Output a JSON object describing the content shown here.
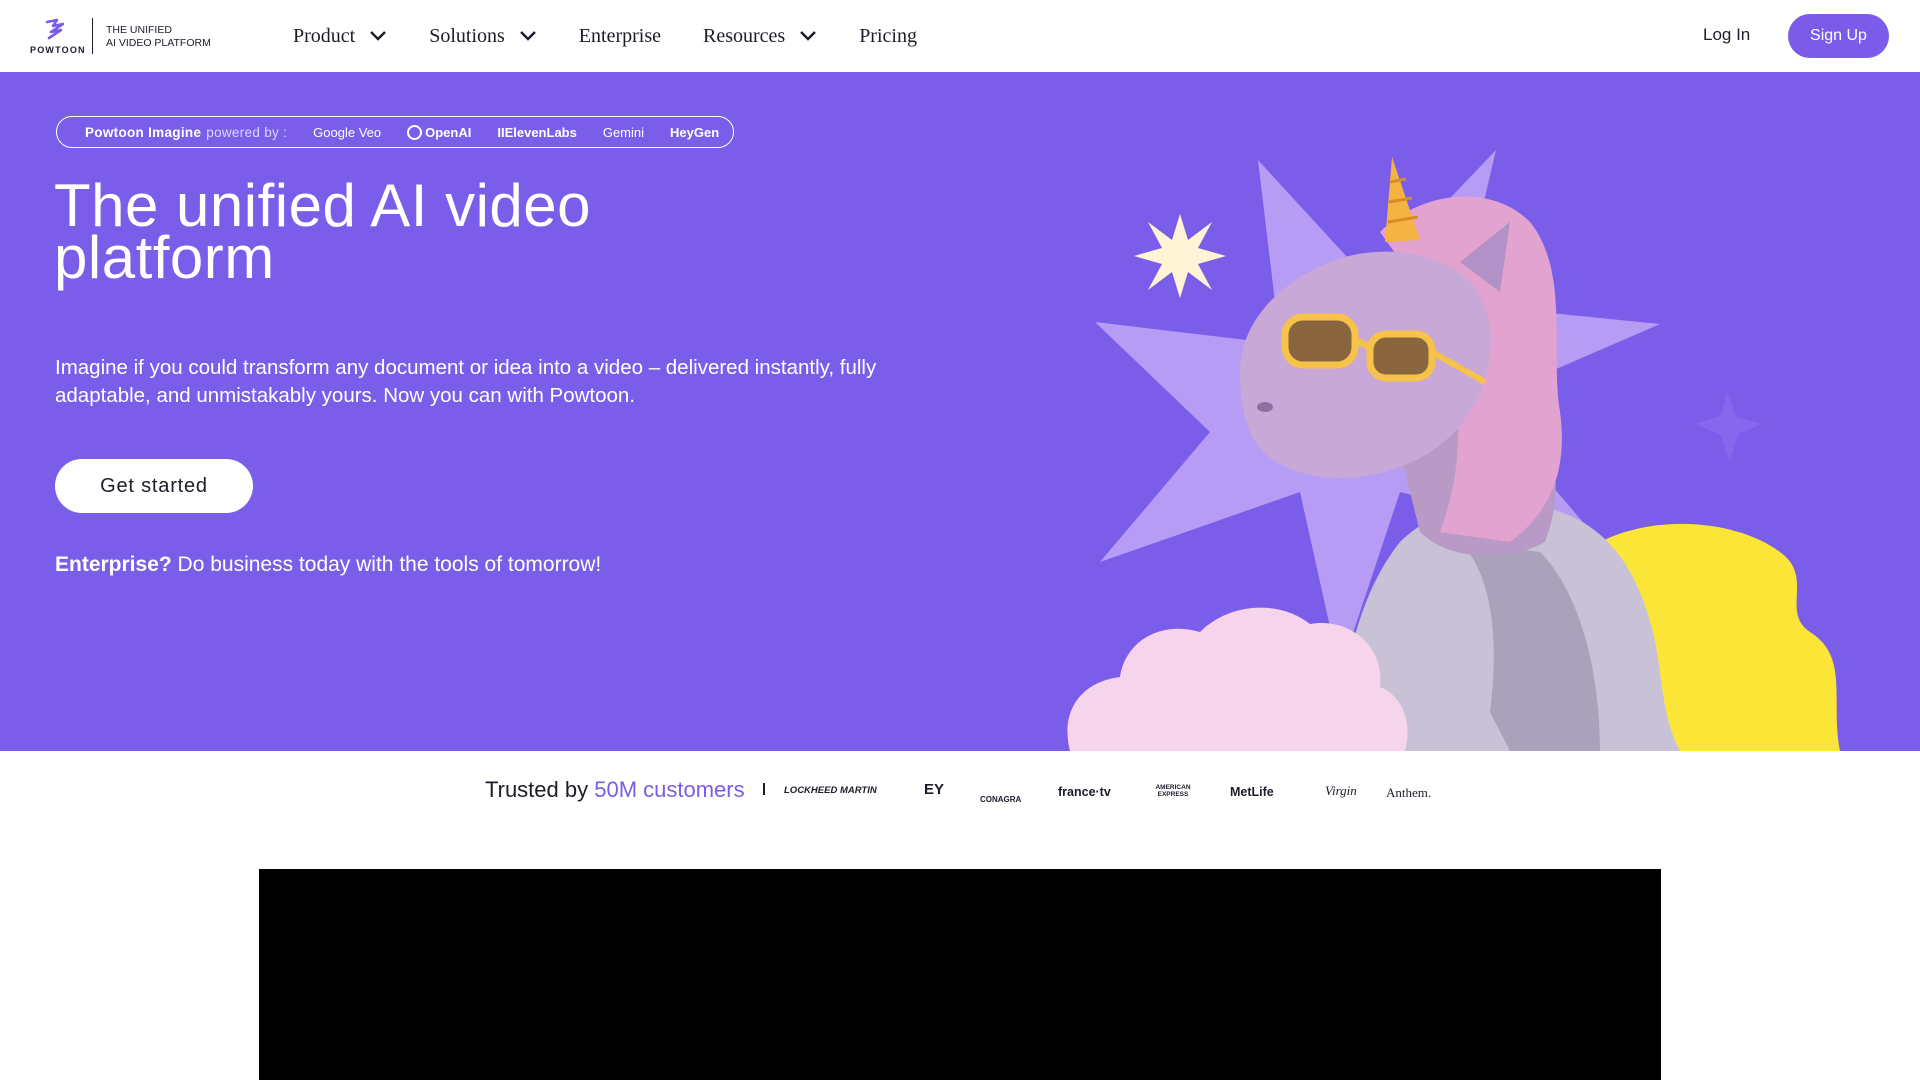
{
  "header": {
    "logo_word": "POWTOON",
    "tagline_line1": "THE UNIFIED",
    "tagline_line2": "AI VIDEO PLATFORM",
    "nav": [
      {
        "label": "Product",
        "has_dropdown": true
      },
      {
        "label": "Solutions",
        "has_dropdown": true
      },
      {
        "label": "Enterprise",
        "has_dropdown": false
      },
      {
        "label": "Resources",
        "has_dropdown": true
      },
      {
        "label": "Pricing",
        "has_dropdown": false
      }
    ],
    "login_label": "Log In",
    "signup_label": "Sign Up"
  },
  "hero": {
    "pill": {
      "brand": "Powtoon Imagine",
      "powered_by": "powered by :",
      "partners": [
        "Google Veo",
        "OpenAI",
        "IIElevenLabs",
        "Gemini",
        "HeyGen"
      ]
    },
    "title": "The unified AI video platform",
    "subtitle": "Imagine if you could transform any document or idea into a video – delivered instantly, fully adaptable, and unmistakably yours. Now you can with Powtoon.",
    "cta_label": "Get started",
    "enterprise_bold": "Enterprise?",
    "enterprise_text": " Do business today with the tools of tomorrow!"
  },
  "trusted": {
    "prefix": "Trusted by ",
    "highlight": "50M customers",
    "customers": [
      "LOCKHEED MARTIN",
      "EY",
      "CONAGRA",
      "france·tv",
      "AMERICAN EXPRESS",
      "MetLife",
      "Virgin",
      "Anthem."
    ]
  },
  "colors": {
    "brand_purple": "#7a5ce8",
    "hero_bg": "#7a5ee9",
    "star_light": "#b79cf5",
    "cloud_pink": "#f6d4ec",
    "yellow_blob": "#fbe638",
    "text_dark": "#1c1c2a"
  }
}
